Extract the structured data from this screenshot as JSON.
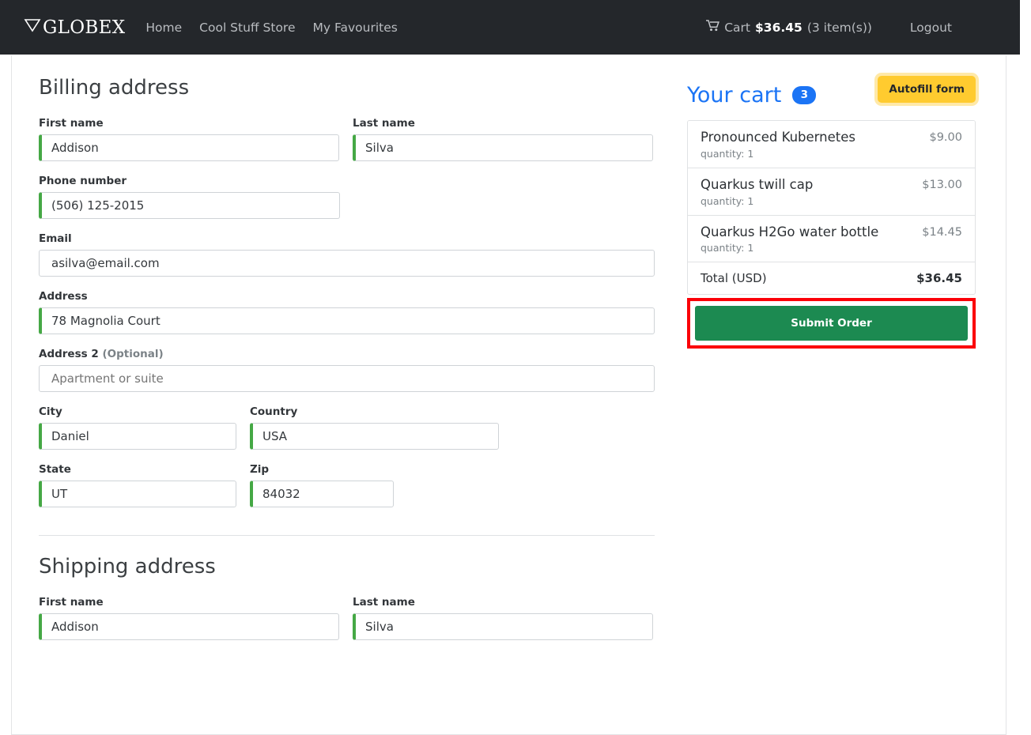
{
  "navbar": {
    "brand": "GLOBEX",
    "brand_icon": "funnel-triangle-icon",
    "links": [
      {
        "label": "Home"
      },
      {
        "label": "Cool Stuff Store"
      },
      {
        "label": "My Favourites"
      }
    ],
    "cart": {
      "icon": "shopping-cart-icon",
      "label": "Cart",
      "amount": "$36.45",
      "count_text": "(3 item(s))"
    },
    "logout": "Logout"
  },
  "billing": {
    "title": "Billing address",
    "first_name": {
      "label": "First name",
      "value": "Addison",
      "valid": true
    },
    "last_name": {
      "label": "Last name",
      "value": "Silva",
      "valid": true
    },
    "phone": {
      "label": "Phone number",
      "value": "(506) 125-2015",
      "valid": true
    },
    "email": {
      "label": "Email",
      "value": "asilva@email.com",
      "valid": false
    },
    "address": {
      "label": "Address",
      "value": "78 Magnolia Court",
      "valid": true
    },
    "address2": {
      "label": "Address 2",
      "optional_label": "(Optional)",
      "value": "",
      "placeholder": "Apartment or suite",
      "valid": false
    },
    "city": {
      "label": "City",
      "value": "Daniel",
      "valid": true
    },
    "country": {
      "label": "Country",
      "value": "USA",
      "valid": true
    },
    "state": {
      "label": "State",
      "value": "UT",
      "valid": true
    },
    "zip": {
      "label": "Zip",
      "value": "84032",
      "valid": true
    }
  },
  "shipping": {
    "title": "Shipping address",
    "first_name": {
      "label": "First name",
      "value": "Addison",
      "valid": true
    },
    "last_name": {
      "label": "Last name",
      "value": "Silva",
      "valid": true
    }
  },
  "cart_panel": {
    "title": "Your cart",
    "badge": "3",
    "autofill_label": "Autofill form",
    "items": [
      {
        "name": "Pronounced Kubernetes",
        "quantity": "quantity: 1",
        "price": "$9.00"
      },
      {
        "name": "Quarkus twill cap",
        "quantity": "quantity: 1",
        "price": "$13.00"
      },
      {
        "name": "Quarkus H2Go water bottle",
        "quantity": "quantity: 1",
        "price": "$14.45"
      }
    ],
    "total_label": "Total (USD)",
    "total_value": "$36.45",
    "submit_label": "Submit Order"
  },
  "colors": {
    "navbar_bg": "#24272b",
    "accent_blue": "#1b74f5",
    "valid_green": "#45a845",
    "submit_green": "#1c8a51",
    "autofill_yellow": "#ffcb2f",
    "highlight_red": "#fb0007"
  }
}
